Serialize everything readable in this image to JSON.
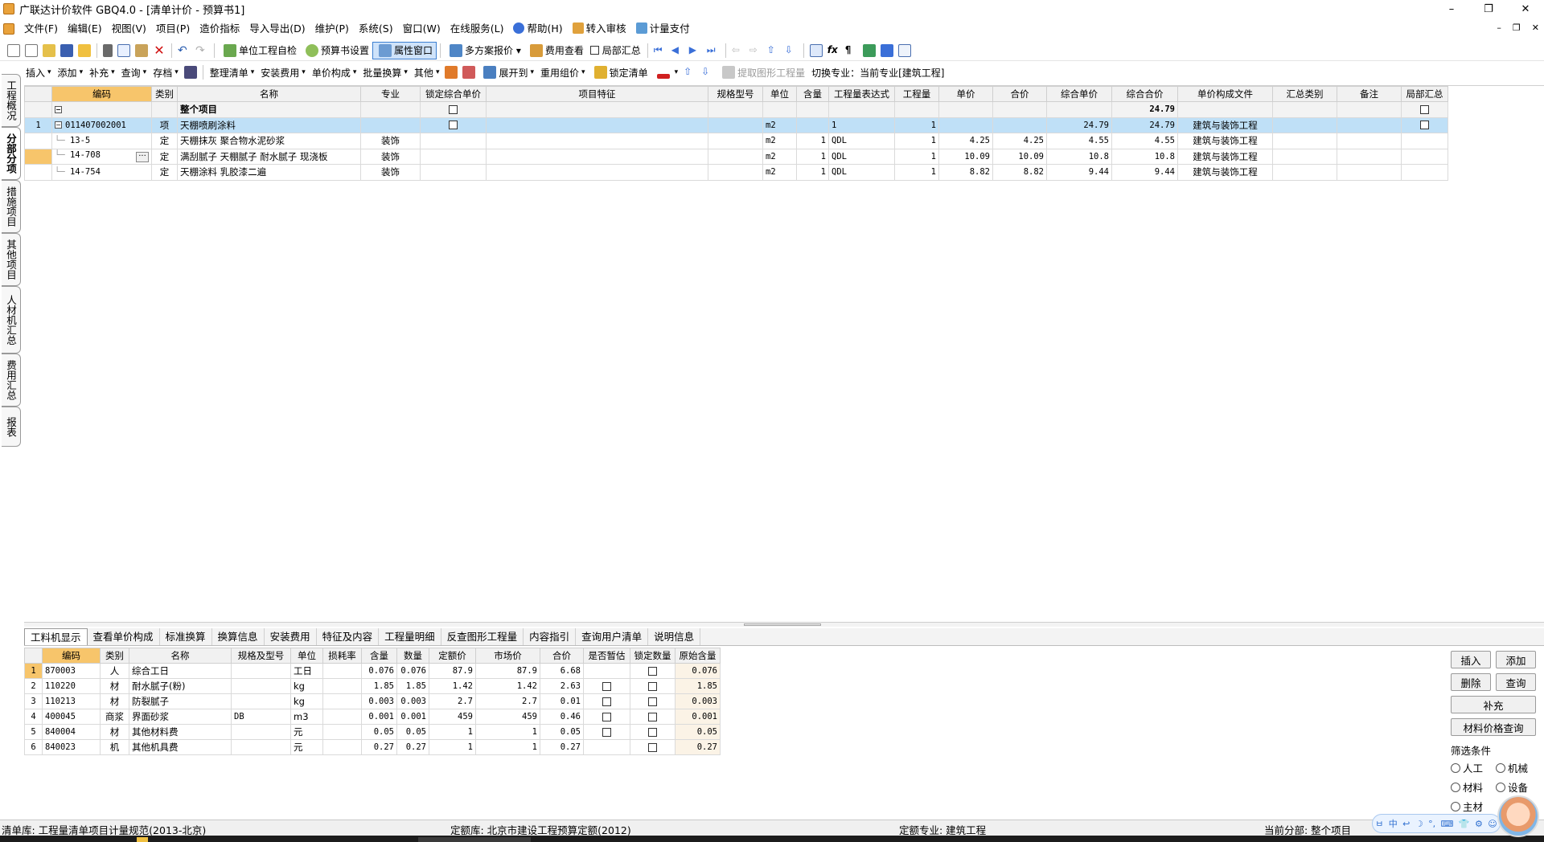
{
  "window": {
    "title": "广联达计价软件 GBQ4.0 - [清单计价 - 预算书1]",
    "controls": [
      "–",
      "❐",
      "✕"
    ],
    "mdi_controls": [
      "–",
      "❐",
      "✕"
    ]
  },
  "menu": [
    {
      "label": "文件(F)"
    },
    {
      "label": "编辑(E)"
    },
    {
      "label": "视图(V)"
    },
    {
      "label": "项目(P)"
    },
    {
      "label": "造价指标"
    },
    {
      "label": "导入导出(D)"
    },
    {
      "label": "维护(P)"
    },
    {
      "label": "系统(S)"
    },
    {
      "label": "窗口(W)"
    },
    {
      "label": "在线服务(L)"
    },
    {
      "label": "帮助(H)",
      "icon": "help-icon"
    },
    {
      "label": "转入审核",
      "icon": "audit-icon"
    },
    {
      "label": "计量支付",
      "icon": "payment-icon"
    }
  ],
  "toolbar1": {
    "self_check": "单位工程自检",
    "budget_settings": "预算书设置",
    "property_window": "属性窗口",
    "multi_plan": "多方案报价",
    "fee_view": "费用查看",
    "partial_summary": "局部汇总"
  },
  "toolbar2": {
    "insert": "插入",
    "add": "添加",
    "supplement": "补充",
    "query": "查询",
    "archive": "存档",
    "organize": "整理清单",
    "install_fee": "安装费用",
    "unit_price": "单价构成",
    "batch_convert": "批量换算",
    "other": "其他",
    "expand_to": "展开到",
    "reuse_price": "重用组价",
    "lock_list": "锁定清单",
    "extract_qty": "提取图形工程量",
    "switch_major": "切换专业：当前专业[建筑工程]"
  },
  "left_tabs": [
    "工程概况",
    "分部分项",
    "措施项目",
    "其他项目",
    "人材机汇总",
    "费用汇总",
    "报表"
  ],
  "main_grid": {
    "headers": [
      "编码",
      "类别",
      "名称",
      "专业",
      "锁定综合单价",
      "项目特征",
      "规格型号",
      "单位",
      "含量",
      "工程量表达式",
      "工程量",
      "单价",
      "合价",
      "综合单价",
      "综合合价",
      "单价构成文件",
      "汇总类别",
      "备注",
      "局部汇总"
    ],
    "top_row": {
      "expander": "−",
      "name": "整个项目",
      "total": "24.79"
    },
    "rows": [
      {
        "num": "1",
        "expander": "−",
        "code": "011407002001",
        "type": "项",
        "name": "天棚喷刷涂料",
        "major": "",
        "unit": "m2",
        "content": "",
        "expr": "1",
        "qty": "1",
        "price": "",
        "amount": "",
        "comp_price": "24.79",
        "comp_amount": "24.79",
        "file": "建筑与装饰工程",
        "checkbox": true
      },
      {
        "num": "",
        "code": "13-5",
        "type": "定",
        "name": "天棚抹灰 聚合物水泥砂浆",
        "major": "装饰",
        "unit": "m2",
        "content": "1",
        "expr": "QDL",
        "qty": "1",
        "price": "4.25",
        "amount": "4.25",
        "comp_price": "4.55",
        "comp_amount": "4.55",
        "file": "建筑与装饰工程"
      },
      {
        "num": "",
        "code": "14-708",
        "type": "定",
        "name": "满刮腻子 天棚腻子 耐水腻子 现浇板",
        "major": "装饰",
        "unit": "m2",
        "content": "1",
        "expr": "QDL",
        "qty": "1",
        "price": "10.09",
        "amount": "10.09",
        "comp_price": "10.8",
        "comp_amount": "10.8",
        "file": "建筑与装饰工程",
        "dots": "···"
      },
      {
        "num": "",
        "code": "14-754",
        "type": "定",
        "name": "天棚涂料 乳胶漆二遍",
        "major": "装饰",
        "unit": "m2",
        "content": "1",
        "expr": "QDL",
        "qty": "1",
        "price": "8.82",
        "amount": "8.82",
        "comp_price": "9.44",
        "comp_amount": "9.44",
        "file": "建筑与装饰工程"
      }
    ]
  },
  "bottom_tabs": [
    "工料机显示",
    "查看单价构成",
    "标准换算",
    "换算信息",
    "安装费用",
    "特征及内容",
    "工程量明细",
    "反查图形工程量",
    "内容指引",
    "查询用户清单",
    "说明信息"
  ],
  "detail_grid": {
    "headers": [
      "编码",
      "类别",
      "名称",
      "规格及型号",
      "单位",
      "损耗率",
      "含量",
      "数量",
      "定额价",
      "市场价",
      "合价",
      "是否暂估",
      "锁定数量",
      "原始含量"
    ],
    "rows": [
      {
        "num": "1",
        "code": "870003",
        "type": "人",
        "name": "综合工日",
        "spec": "",
        "unit": "工日",
        "loss": "",
        "content": "0.076",
        "qty": "0.076",
        "quota": "87.9",
        "market": "87.9",
        "amount": "6.68",
        "est": false,
        "lock": true,
        "orig": "0.076"
      },
      {
        "num": "2",
        "code": "110220",
        "type": "材",
        "name": "耐水腻子(粉)",
        "spec": "",
        "unit": "kg",
        "loss": "",
        "content": "1.85",
        "qty": "1.85",
        "quota": "1.42",
        "market": "1.42",
        "amount": "2.63",
        "est": true,
        "lock": true,
        "orig": "1.85"
      },
      {
        "num": "3",
        "code": "110213",
        "type": "材",
        "name": "防裂腻子",
        "spec": "",
        "unit": "kg",
        "loss": "",
        "content": "0.003",
        "qty": "0.003",
        "quota": "2.7",
        "market": "2.7",
        "amount": "0.01",
        "est": true,
        "lock": true,
        "orig": "0.003"
      },
      {
        "num": "4",
        "code": "400045",
        "type": "商浆",
        "name": "界面砂浆",
        "spec": "DB",
        "unit": "m3",
        "loss": "",
        "content": "0.001",
        "qty": "0.001",
        "quota": "459",
        "market": "459",
        "amount": "0.46",
        "est": true,
        "lock": true,
        "orig": "0.001"
      },
      {
        "num": "5",
        "code": "840004",
        "type": "材",
        "name": "其他材料费",
        "spec": "",
        "unit": "元",
        "loss": "",
        "content": "0.05",
        "qty": "0.05",
        "quota": "1",
        "market": "1",
        "amount": "0.05",
        "est": true,
        "lock": true,
        "orig": "0.05"
      },
      {
        "num": "6",
        "code": "840023",
        "type": "机",
        "name": "其他机具费",
        "spec": "",
        "unit": "元",
        "loss": "",
        "content": "0.27",
        "qty": "0.27",
        "quota": "1",
        "market": "1",
        "amount": "0.27",
        "est": false,
        "lock": true,
        "orig": "0.27"
      }
    ]
  },
  "right_panel": {
    "insert": "插入",
    "add": "添加",
    "delete": "删除",
    "query": "查询",
    "supplement": "补充",
    "price_query": "材料价格查询",
    "filter_title": "筛选条件",
    "filters": [
      "人工",
      "机械",
      "材料",
      "设备",
      "主材"
    ]
  },
  "status": {
    "list_lib": "清单库:  工程量清单项目计量规范(2013-北京)",
    "quota_lib": "定额库:  北京市建设工程预算定额(2012)",
    "quota_major": "定额专业:  建筑工程",
    "current_part": "当前分部:  整个项目"
  },
  "ime": {
    "items": [
      "ㅂ",
      "中",
      "↩",
      "☽",
      "°,",
      "⌨",
      "👕",
      "⚙",
      "☺"
    ]
  },
  "colors": {
    "header_selected": "#f7c56b",
    "row_highlight": "#bfe0f7",
    "active_tab_border": "#3c7fd1"
  }
}
